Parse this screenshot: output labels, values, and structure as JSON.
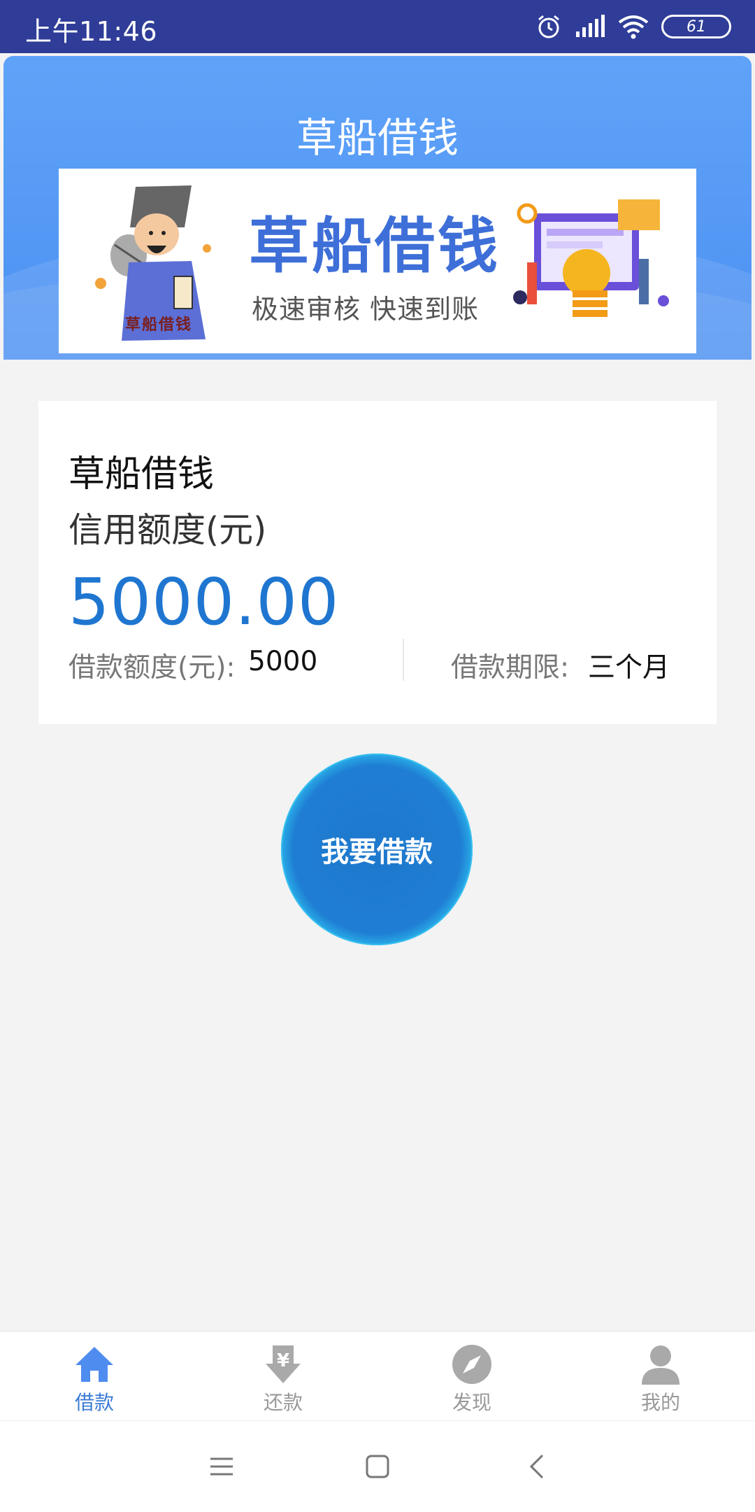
{
  "status_bar": {
    "time": "上午11:46",
    "battery": "61"
  },
  "header": {
    "title": "草船借钱"
  },
  "banner": {
    "brand": "草船借钱",
    "slogan": "极速审核 快速到账",
    "mascot_caption": "草船借钱"
  },
  "card": {
    "title": "草船借钱",
    "credit_label": "信用额度(元)",
    "credit_amount": "5000.00",
    "limit_label": "借款额度(元):",
    "limit_value": "5000",
    "term_label": "借款期限:",
    "term_value": "三个月"
  },
  "borrow_button": {
    "label": "我要借款"
  },
  "tabs": [
    {
      "label": "借款",
      "icon": "home-icon",
      "active": true
    },
    {
      "label": "还款",
      "icon": "yen-download-icon",
      "active": false
    },
    {
      "label": "发现",
      "icon": "compass-icon",
      "active": false
    },
    {
      "label": "我的",
      "icon": "user-icon",
      "active": false
    }
  ],
  "colors": {
    "status_bar": "#2f3d98",
    "header": "#5fa3f9",
    "amount": "#1f76d0",
    "tab_active": "#3a7bd5",
    "tab_inactive": "#999999"
  }
}
